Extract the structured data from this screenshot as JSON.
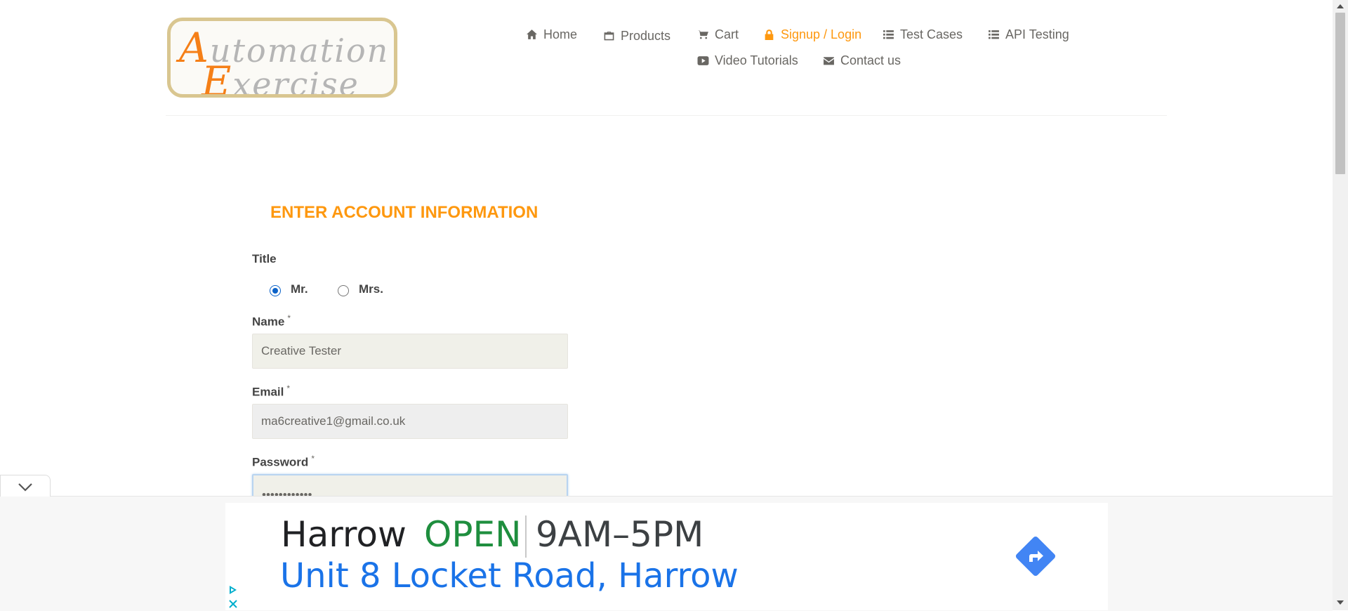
{
  "logo": {
    "line1_cap": "A",
    "line1_rest": "utomation",
    "line2_cap": "E",
    "line2_rest": "xercise"
  },
  "nav": {
    "items": [
      {
        "label": "Home",
        "icon": "home-icon"
      },
      {
        "label": "Products",
        "icon": "briefcase-icon"
      },
      {
        "label": "Cart",
        "icon": "cart-icon"
      },
      {
        "label": "Signup / Login",
        "icon": "lock-icon",
        "active": true
      },
      {
        "label": "Test Cases",
        "icon": "list-icon"
      },
      {
        "label": "API Testing",
        "icon": "list-icon"
      },
      {
        "label": "Video Tutorials",
        "icon": "youtube-icon"
      },
      {
        "label": "Contact us",
        "icon": "envelope-icon"
      }
    ]
  },
  "form": {
    "heading": "ENTER ACCOUNT INFORMATION",
    "title_label": "Title",
    "title_options": [
      {
        "label": "Mr.",
        "checked": true
      },
      {
        "label": "Mrs.",
        "checked": false
      }
    ],
    "name_label": "Name",
    "name_value": "Creative Tester",
    "email_label": "Email",
    "email_value": "ma6creative1@gmail.co.uk",
    "password_label": "Password",
    "password_value": "••••••••••••",
    "required_mark": "*"
  },
  "ad": {
    "business": "Harrow",
    "status": "OPEN",
    "hours": "9AM–5PM",
    "address": "Unit 8 Locket Road, Harrow",
    "colors": {
      "open": "#1e8e3e",
      "address": "#1a73e8",
      "directions": "#4285f4"
    }
  },
  "colors": {
    "accent": "#fe980f",
    "radio_checked": "#0b62c8"
  }
}
